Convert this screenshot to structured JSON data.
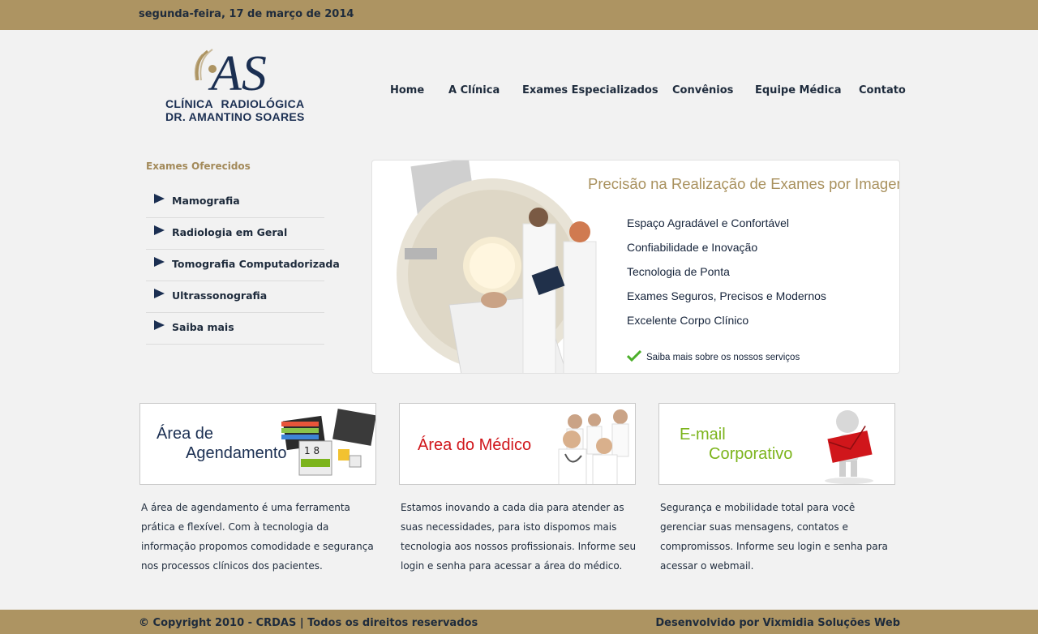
{
  "header": {
    "date": "segunda-feira, 17 de março de 2014"
  },
  "logo": {
    "monogram": "AS",
    "line1": "CLÍNICA RADIOLÓGICA",
    "line2": "DR. AMANTINO SOARES"
  },
  "nav": [
    {
      "label": "Home"
    },
    {
      "label": "A Clínica"
    },
    {
      "label": "Exames Especializados"
    },
    {
      "label": "Convênios"
    },
    {
      "label": "Equipe Médica"
    },
    {
      "label": "Contato"
    }
  ],
  "sidebar": {
    "title": "Exames Oferecidos",
    "items": [
      {
        "label": "Mamografia"
      },
      {
        "label": "Radiologia em Geral"
      },
      {
        "label": "Tomografia Computadorizada"
      },
      {
        "label": "Ultrassonografia"
      },
      {
        "label": "Saiba mais"
      }
    ]
  },
  "banner": {
    "headline": "Precisão na Realização de Exames por Imagem",
    "features": [
      "Espaço Agradável e Confortável",
      "Confiabilidade e Inovação",
      "Tecnologia de Ponta",
      "Exames Seguros, Precisos e Modernos",
      "Excelente Corpo Clínico"
    ],
    "more_link": "Saiba mais sobre os nossos serviços"
  },
  "cards": [
    {
      "title_line1": "Área de",
      "title_line2": "Agendamento",
      "description": "A área de agendamento é uma ferramenta prática e flexível. Com à tecnologia da informação propomos comodidade e segurança nos processos clínicos dos pacientes."
    },
    {
      "title_line1": "Área do Médico",
      "title_line2": "",
      "description": "Estamos inovando a cada dia para atender as suas necessidades, para isto dispomos mais tecnologia aos nossos profissionais. Informe seu login e senha para acessar a área do médico."
    },
    {
      "title_line1": "E-mail",
      "title_line2": "Corporativo",
      "description": "Segurança e mobilidade total para você gerenciar suas mensagens, contatos e compromissos. Informe seu login e senha para acessar o webmail."
    }
  ],
  "footer": {
    "copyright": "© Copyright 2010 - CRDAS | Todos os direitos reservados",
    "developer": "Desenvolvido por Vixmidia Soluções Web"
  },
  "colors": {
    "brand_gold": "#ad9462",
    "navy": "#1b2f52",
    "red": "#d0161b",
    "green": "#7cb41c"
  }
}
